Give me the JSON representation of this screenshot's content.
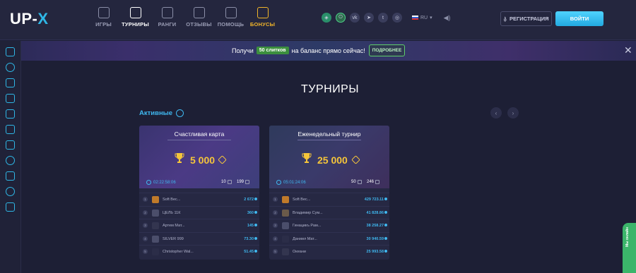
{
  "header": {
    "logo_main": "UP-",
    "logo_x": "X",
    "nav": [
      {
        "label": "ИГРЫ",
        "icon": "dice-icon",
        "state": "default"
      },
      {
        "label": "ТУРНИРЫ",
        "icon": "trophy-icon",
        "state": "active"
      },
      {
        "label": "РАНГИ",
        "icon": "rank-icon",
        "state": "default"
      },
      {
        "label": "ОТЗЫВЫ",
        "icon": "reviews-icon",
        "state": "default"
      },
      {
        "label": "ПОМОЩЬ",
        "icon": "help-icon",
        "state": "default"
      },
      {
        "label": "БОНУСЫ",
        "icon": "bonus-icon",
        "state": "bonus"
      }
    ],
    "socials": [
      "shield-icon",
      "power-icon",
      "vk-icon",
      "telegram-icon",
      "twitter-icon",
      "instagram-icon"
    ],
    "language": "RU",
    "register_label": "РЕГИСТРАЦИЯ",
    "login_label": "ВОЙТИ"
  },
  "banner": {
    "text_before": "Получи",
    "chip": "50 слитков",
    "text_after": "на баланс прямо сейчас!",
    "button": "ПОДРОБНЕЕ"
  },
  "main": {
    "title": "ТУРНИРЫ",
    "active_label": "Активные"
  },
  "cards": [
    {
      "name": "Счастливая карта",
      "prize": "5 000",
      "timer": "02:22:58:06",
      "stat1": "10",
      "stat2": "199",
      "rows": [
        {
          "rank": "1",
          "name": "Soft Bec...",
          "score": "2 672",
          "avatar": "gold"
        },
        {
          "rank": "2",
          "name": "ЦЕЛЬ 11К",
          "score": "360",
          "avatar": "grey"
        },
        {
          "rank": "3",
          "name": "Артем Мат...",
          "score": "145",
          "avatar": "dark"
        },
        {
          "rank": "4",
          "name": "SILVER 999",
          "score": "73.30",
          "avatar": "grey"
        },
        {
          "rank": "5",
          "name": "Christopher Wal...",
          "score": "51.45",
          "avatar": "user"
        }
      ]
    },
    {
      "name": "Еженедельный турнир",
      "prize": "25 000",
      "timer": "05:01:24:06",
      "stat1": "50",
      "stat2": "246",
      "rows": [
        {
          "rank": "1",
          "name": "Soft Bec...",
          "score": "429 723.11",
          "avatar": "gold"
        },
        {
          "rank": "2",
          "name": "Владимир Сум...",
          "score": "41 828.86",
          "avatar": "grey"
        },
        {
          "rank": "3",
          "name": "Гинацикъ Рам...",
          "score": "38 258.27",
          "avatar": "grey"
        },
        {
          "rank": "4",
          "name": "Даниил Мат...",
          "score": "30 940.59",
          "avatar": "user"
        },
        {
          "rank": "5",
          "name": "Океани",
          "score": "25 993.58",
          "avatar": "dark"
        }
      ]
    }
  ],
  "chat_tab": "Мы онлайн"
}
